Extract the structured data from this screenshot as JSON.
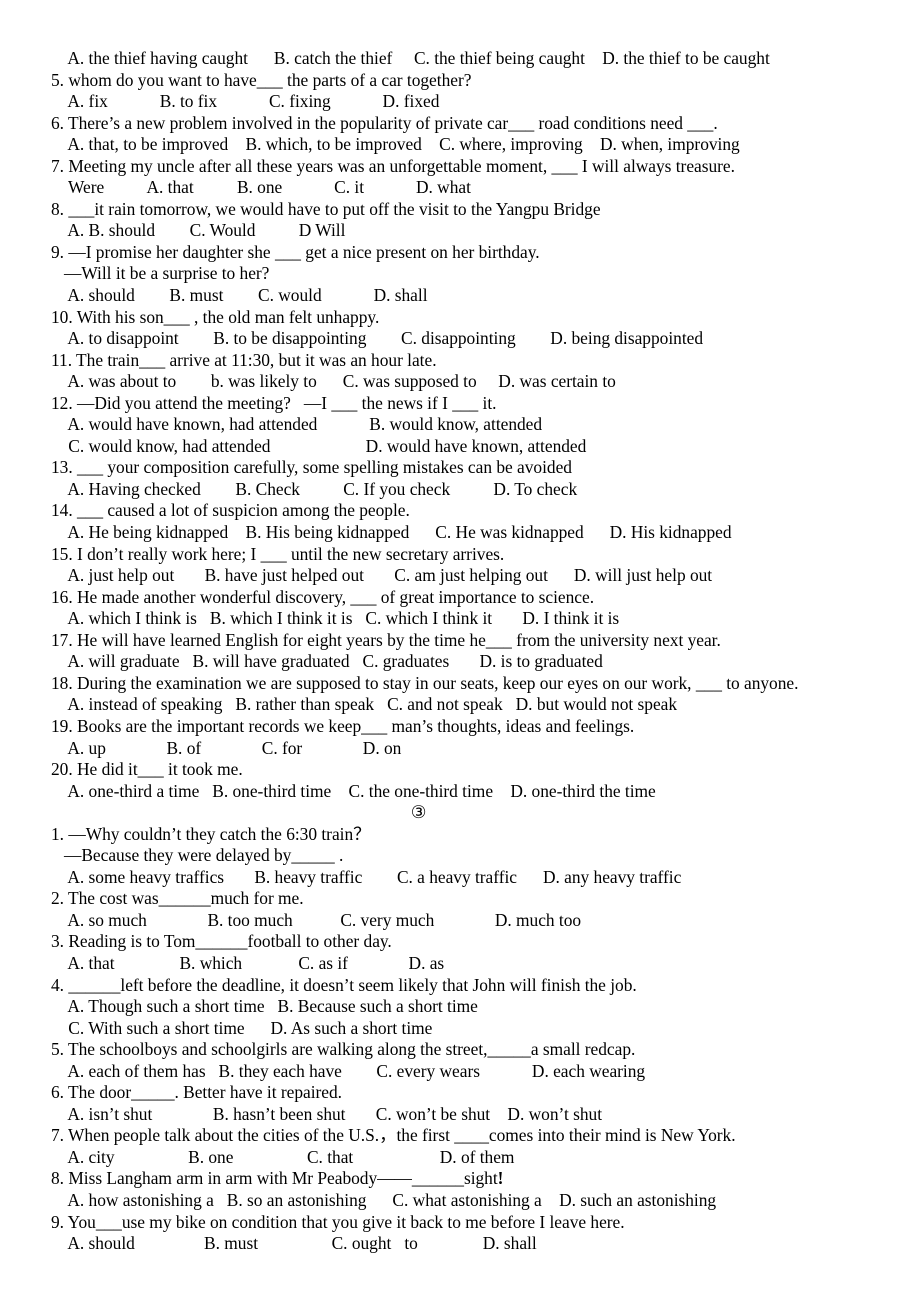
{
  "document": {
    "type": "english-grammar-multiple-choice-worksheet",
    "text_color": "#000000",
    "background_color": "#ffffff"
  },
  "section_divider": {
    "label": "③"
  },
  "part_one": {
    "lines": [
      "    A. the thief having caught      B. catch the thief     C. the thief being caught    D. the thief to be caught",
      "5. whom do you want to have___ the parts of a car together?",
      "    A. fix            B. to fix            C. fixing            D. fixed",
      "6. There’s a new problem involved in the popularity of private car___ road conditions need ___.",
      "    A. that, to be improved    B. which, to be improved    C. where, improving    D. when, improving",
      "7. Meeting my uncle after all these years was an unforgettable moment, ___ I will always treasure.",
      "    Were          A. that          B. one            C. it            D. what",
      "8. ___it rain tomorrow, we would have to put off the visit to the Yangpu Bridge",
      "    A. B. should        C. Would          D Will",
      "9. —I promise her daughter she ___ get a nice present on her birthday.",
      "   —Will it be a surprise to her?",
      "    A. should        B. must        C. would            D. shall",
      "10. With his son___ , the old man felt unhappy.",
      "    A. to disappoint        B. to be disappointing        C. disappointing        D. being disappointed",
      "11. The train___ arrive at 11:30, but it was an hour late.",
      "    A. was about to        b. was likely to      C. was supposed to     D. was certain to",
      "12. —Did you attend the meeting?   —I ___ the news if I ___ it.",
      "    A. would have known, had attended            B. would know, attended",
      "    C. would know, had attended                      D. would have known, attended",
      "13. ___ your composition carefully, some spelling mistakes can be avoided",
      "    A. Having checked        B. Check          C. If you check          D. To check",
      "14. ___ caused a lot of suspicion among the people.",
      "    A. He being kidnapped    B. His being kidnapped      C. He was kidnapped      D. His kidnapped",
      "15. I don’t really work here; I ___ until the new secretary arrives.",
      "    A. just help out       B. have just helped out       C. am just helping out      D. will just help out",
      "16. He made another wonderful discovery, ___ of great importance to science.",
      "    A. which I think is   B. which I think it is   C. which I think it       D. I think it is",
      "17. He will have learned English for eight years by the time he___ from the university next year.",
      "    A. will graduate   B. will have graduated   C. graduates       D. is to graduated",
      "18. During the examination we are supposed to stay in our seats, keep our eyes on our work, ___ to anyone.",
      "    A. instead of speaking   B. rather than speak   C. and not speak   D. but would not speak",
      "19. Books are the important records we keep___ man’s thoughts, ideas and feelings.",
      "    A. up              B. of              C. for              D. on",
      "20. He did it___ it took me.",
      "    A. one-third a time   B. one-third time    C. the one-third time    D. one-third the time"
    ]
  },
  "part_two": {
    "lines": [
      "1. —Why couldn’t they catch the 6:30 train？",
      "   —Because they were delayed by_____ .",
      "    A. some heavy traffics       B. heavy traffic        C. a heavy traffic      D. any heavy traffic",
      "2. The cost was______much for me.",
      "    A. so much              B. too much           C. very much              D. much too",
      "3. Reading is to Tom______football to other day.",
      "    A. that               B. which             C. as if              D. as",
      "4. ______left before the deadline, it doesn’t seem likely that John will finish the job.",
      "    A. Though such a short time   B. Because such a short time",
      "    C. With such a short time      D. As such a short time",
      "5. The schoolboys and schoolgirls are walking along the street,_____a small redcap.",
      "    A. each of them has   B. they each have        C. every wears            D. each wearing",
      "6. The door_____. Better have it repaired.",
      "    A. isn’t shut              B. hasn’t been shut       C. won’t be shut    D. won’t shut",
      "7. When people talk about the cities of the U.S.，the first ____comes into their mind is New York.",
      "    A. city                 B. one                 C. that                    D. of them"
    ],
    "line_astonishing_stem_prefix": "8. Miss Langham arm in arm with Mr Peabody——______sight",
    "line_astonishing_bang": "!",
    "lines_tail": [
      "    A. how astonishing a   B. so an astonishing      C. what astonishing a    D. such an astonishing",
      "9. You___use my bike on condition that you give it back to me before I leave here.",
      "    A. should                B. must                 C. ought   to               D. shall"
    ]
  }
}
